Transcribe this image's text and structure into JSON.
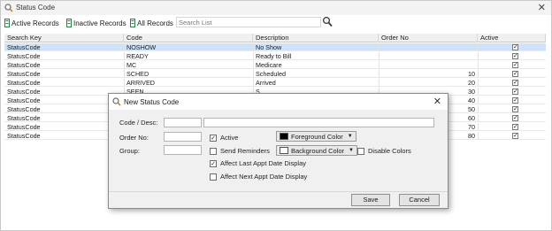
{
  "window": {
    "title": "Status Code",
    "accent": "#3a78c3"
  },
  "toolbar": {
    "active_label": "Active Records",
    "inactive_label": "Inactive Records",
    "all_label": "All Records",
    "search_placeholder": "Search List"
  },
  "grid": {
    "columns": [
      "Search Key",
      "Code",
      "Description",
      "Order No",
      "Active"
    ],
    "rows": [
      {
        "key": "StatusCode",
        "code": "NOSHOW",
        "desc": "No Show",
        "order": "",
        "active": true
      },
      {
        "key": "StatusCode",
        "code": "READY",
        "desc": "Ready to Bill",
        "order": "",
        "active": true
      },
      {
        "key": "StatusCode",
        "code": "MC",
        "desc": "Medicare",
        "order": "",
        "active": true
      },
      {
        "key": "StatusCode",
        "code": "SCHED",
        "desc": "Scheduled",
        "order": "10",
        "active": true
      },
      {
        "key": "StatusCode",
        "code": "ARRIVED",
        "desc": "Arrived",
        "order": "20",
        "active": true
      },
      {
        "key": "StatusCode",
        "code": "SEEN",
        "desc": "S",
        "order": "30",
        "active": true
      },
      {
        "key": "StatusCode",
        "code": "",
        "desc": "",
        "order": "40",
        "active": true
      },
      {
        "key": "StatusCode",
        "code": "",
        "desc": "",
        "order": "50",
        "active": true
      },
      {
        "key": "StatusCode",
        "code": "",
        "desc": "",
        "order": "60",
        "active": true
      },
      {
        "key": "StatusCode",
        "code": "",
        "desc": "",
        "order": "70",
        "active": true
      },
      {
        "key": "StatusCode",
        "code": "",
        "desc": "",
        "order": "80",
        "active": true
      }
    ]
  },
  "dialog": {
    "title": "New Status Code",
    "code_label": "Code / Desc:",
    "order_label": "Order No:",
    "group_label": "Group:",
    "active_label": "Active",
    "send_reminders_label": "Send Reminders",
    "affect_last_label": "Affect Last Appt Date Display",
    "affect_next_label": "Affect Next Appt Date Display",
    "foreground_label": "Foreground Color",
    "background_label": "Background Color",
    "disable_colors_label": "Disable Colors",
    "save_label": "Save",
    "cancel_label": "Cancel",
    "foreground_color": "#000000",
    "background_color": "#ffffff"
  }
}
